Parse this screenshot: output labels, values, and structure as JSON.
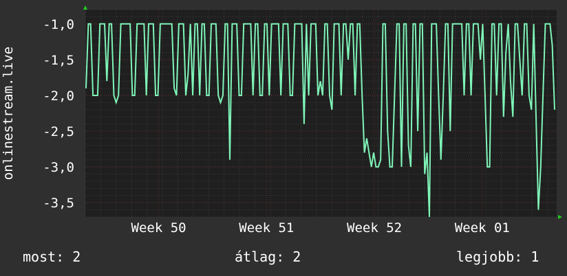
{
  "colors": {
    "background": "#2f2f2f",
    "plot_background": "#1f1f1f",
    "grid": "#3c3c3c",
    "week_grid": "#5a2a2a",
    "line": "#7ff5b8",
    "axis_arrow": "#22cc22"
  },
  "legend": {
    "now": "most: 2",
    "average": "átlag: 2",
    "best": "legjobb: 1"
  },
  "chart_data": {
    "type": "line",
    "ylabel": "onlinestream.live",
    "ylim": [
      -3.7,
      -0.8
    ],
    "y_ticks": [
      -1.0,
      -1.5,
      -2.0,
      -2.5,
      -3.0,
      -3.5
    ],
    "y_tick_labels": [
      "-1,0",
      "-1,5",
      "-2,0",
      "-2,5",
      "-3,0",
      "-3,5"
    ],
    "x_tick_labels": [
      "Week 50",
      "Week 51",
      "Week 52",
      "Week 01"
    ],
    "x_tick_positions": [
      1.0,
      2.0,
      3.0,
      4.0
    ],
    "xlim": [
      0.32,
      4.69
    ],
    "grid": true,
    "series": [
      {
        "values": [
          -1.9,
          -1.0,
          -1.0,
          -2.0,
          -2.0,
          -2.0,
          -1.0,
          -1.0,
          -1.0,
          -1.8,
          -1.0,
          -1.0,
          -2.0,
          -2.1,
          -2.0,
          -1.0,
          -1.0,
          -1.0,
          -1.0,
          -1.0,
          -2.0,
          -2.0,
          -1.0,
          -1.0,
          -1.0,
          -1.0,
          -2.0,
          -1.0,
          -1.0,
          -1.0,
          -2.0,
          -2.0,
          -1.0,
          -1.0,
          -1.0,
          -1.0,
          -1.0,
          -1.0,
          -1.9,
          -2.0,
          -1.0,
          -1.0,
          -1.0,
          -2.0,
          -1.7,
          -1.0,
          -2.0,
          -1.0,
          -1.0,
          -2.0,
          -1.0,
          -1.0,
          -2.0,
          -2.0,
          -1.0,
          -1.0,
          -1.0,
          -2.0,
          -2.1,
          -2.0,
          -1.0,
          -1.0,
          -2.9,
          -1.0,
          -1.0,
          -1.0,
          -2.0,
          -2.0,
          -1.0,
          -1.0,
          -1.0,
          -1.0,
          -2.0,
          -1.0,
          -1.0,
          -2.0,
          -2.0,
          -1.0,
          -1.0,
          -2.0,
          -1.0,
          -1.0,
          -1.0,
          -1.0,
          -2.0,
          -1.0,
          -1.0,
          -1.0,
          -2.0,
          -2.0,
          -1.0,
          -1.0,
          -1.0,
          -1.0,
          -2.4,
          -1.0,
          -2.0,
          -1.0,
          -1.0,
          -1.0,
          -2.0,
          -1.8,
          -2.0,
          -1.0,
          -1.0,
          -2.0,
          -2.2,
          -1.0,
          -1.0,
          -1.0,
          -2.0,
          -1.0,
          -1.0,
          -1.5,
          -1.0,
          -1.0,
          -2.0,
          -1.0,
          -1.0,
          -2.0,
          -2.8,
          -2.6,
          -2.8,
          -3.0,
          -2.8,
          -3.0,
          -3.0,
          -2.9,
          -1.0,
          -1.0,
          -2.5,
          -3.0,
          -3.0,
          -2.0,
          -1.0,
          -1.0,
          -3.0,
          -1.0,
          -1.0,
          -2.7,
          -3.0,
          -1.0,
          -1.0,
          -2.5,
          -1.0,
          -1.0,
          -3.1,
          -2.8,
          -3.7,
          -1.0,
          -1.0,
          -1.0,
          -2.0,
          -2.9,
          -2.0,
          -1.0,
          -1.0,
          -2.5,
          -1.0,
          -1.0,
          -1.0,
          -1.0,
          -1.0,
          -2.0,
          -1.0,
          -1.0,
          -2.0,
          -1.0,
          -1.0,
          -1.0,
          -1.5,
          -1.0,
          -2.0,
          -3.0,
          -3.0,
          -1.0,
          -1.0,
          -2.0,
          -1.0,
          -1.0,
          -2.3,
          -1.4,
          -1.0,
          -1.8,
          -2.3,
          -1.0,
          -1.0,
          -1.5,
          -2.0,
          -1.0,
          -1.0,
          -2.0,
          -2.2,
          -1.0,
          -2.3,
          -3.6,
          -3.0,
          -2.0,
          -1.0,
          -1.0,
          -1.0,
          -1.3,
          -2.2
        ]
      }
    ]
  }
}
